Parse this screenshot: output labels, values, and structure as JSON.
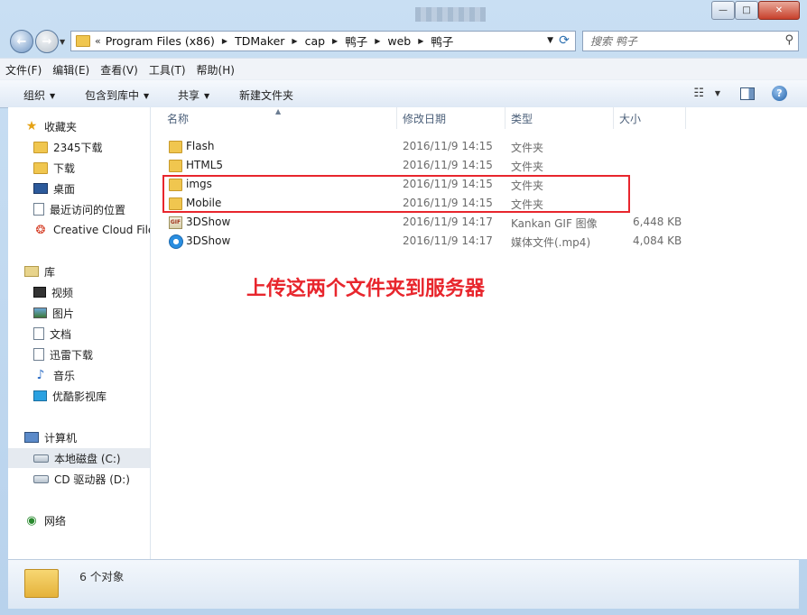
{
  "window": {
    "caption": {
      "minimize": "—",
      "maximize": "□",
      "close": "✕"
    }
  },
  "address": {
    "chevron": "«",
    "crumbs": [
      "Program Files (x86)",
      "TDMaker",
      "cap",
      "鸭子",
      "web",
      "鸭子"
    ],
    "search_placeholder": "搜索 鸭子"
  },
  "menu": [
    "文件(F)",
    "编辑(E)",
    "查看(V)",
    "工具(T)",
    "帮助(H)"
  ],
  "commands": {
    "organize": "组织",
    "include_in_library": "包含到库中",
    "share": "共享",
    "new_folder": "新建文件夹"
  },
  "nav": {
    "favorites": "收藏夹",
    "fav_items": [
      "2345下载",
      "下载",
      "桌面",
      "最近访问的位置",
      "Creative Cloud Files"
    ],
    "libraries": "库",
    "lib_items": [
      "视频",
      "图片",
      "文档",
      "迅雷下载",
      "音乐",
      "优酷影视库"
    ],
    "computer": "计算机",
    "computer_items": [
      "本地磁盘 (C:)",
      "CD 驱动器 (D:)"
    ],
    "network": "网络"
  },
  "columns": {
    "name": "名称",
    "date": "修改日期",
    "type": "类型",
    "size": "大小"
  },
  "files": [
    {
      "name": "Flash",
      "date": "2016/11/9 14:15",
      "type": "文件夹",
      "size": "",
      "icon": "folder"
    },
    {
      "name": "HTML5",
      "date": "2016/11/9 14:15",
      "type": "文件夹",
      "size": "",
      "icon": "folder"
    },
    {
      "name": "imgs",
      "date": "2016/11/9 14:15",
      "type": "文件夹",
      "size": "",
      "icon": "folder"
    },
    {
      "name": "Mobile",
      "date": "2016/11/9 14:15",
      "type": "文件夹",
      "size": "",
      "icon": "folder"
    },
    {
      "name": "3DShow",
      "date": "2016/11/9 14:17",
      "type": "Kankan GIF 图像",
      "size": "6,448 KB",
      "icon": "gif"
    },
    {
      "name": "3DShow",
      "date": "2016/11/9 14:17",
      "type": "媒体文件(.mp4)",
      "size": "4,084 KB",
      "icon": "mp4"
    }
  ],
  "annotation": "上传这两个文件夹到服务器",
  "status": {
    "count": "6 个对象"
  },
  "colors": {
    "annotation": "#e8262d",
    "selection": "#e5eaf0"
  }
}
